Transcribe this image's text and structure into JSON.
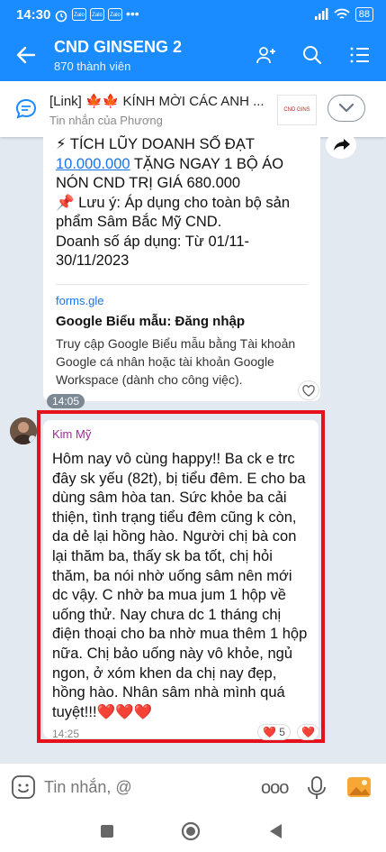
{
  "status": {
    "time": "14:30",
    "battery": "88",
    "icons": [
      "alarm-icon",
      "zalo-icon",
      "zalo-icon",
      "zalo-icon",
      "more-dots-icon"
    ]
  },
  "header": {
    "title": "CND GINSENG 2",
    "subtitle": "870 thành viên"
  },
  "pinned": {
    "title": "[Link] 🍁🍁  KÍNH MỜI CÁC ANH ...",
    "subtitle": "Tin nhắn của Phương",
    "thumb": "CND GINS"
  },
  "message1": {
    "line1": "⚡ TÍCH LŨY DOANH SỐ ĐẠT",
    "amount": "10.000.000",
    "line2": " TẶNG NGAY 1 BỘ ÁO NÓN CND TRỊ GIÁ 680.000",
    "line3": "📌 Lưu ý: Áp dụng cho toàn bộ sản phẩm Sâm Bắc Mỹ CND.",
    "line4": "Doanh số áp dụng: Từ 01/11-30/11/2023",
    "link_domain": "forms.gle",
    "link_title": "Google Biểu mẫu: Đăng nhập",
    "link_desc": "Truy cập Google Biểu mẫu bằng Tài khoản Google cá nhân hoặc tài khoản Google Workspace (dành cho công việc).",
    "time": "14:05"
  },
  "message2": {
    "sender": "Kim Mỹ",
    "text": "Hôm nay vô cùng happy!! Ba ck e trc đây sk yếu (82t), bị tiểu đêm. E cho ba dùng sâm hòa tan. Sức khỏe ba cải thiện, tình trạng tiểu đêm cũng k còn, da dẻ lại hồng hào. Người chị bà con lại thăm ba, thấy sk ba tốt, chị hỏi thăm, ba nói nhờ uống sâm nên mới dc vậy. C nhờ ba mua jum 1 hộp về uống thử. Nay chưa dc 1 tháng chị điện thoại cho ba nhờ mua thêm 1 hộp nữa. Chị bảo uống này vô khỏe, ngủ ngon, ở xóm khen da chị nay đẹp, hồng hào. Nhân sâm nhà mình quá tuyệt!!!❤️❤️❤️",
    "time": "14:25",
    "reaction_count": "5",
    "reaction_heart": "❤️"
  },
  "input": {
    "placeholder": "Tin nhắn, @",
    "more": "ooo"
  },
  "colors": {
    "header": "#1a8cff",
    "chat_bg": "#e2e9f1",
    "highlight": "#e5121d",
    "link": "#1a73e8",
    "sender": "#9b2a8f"
  }
}
